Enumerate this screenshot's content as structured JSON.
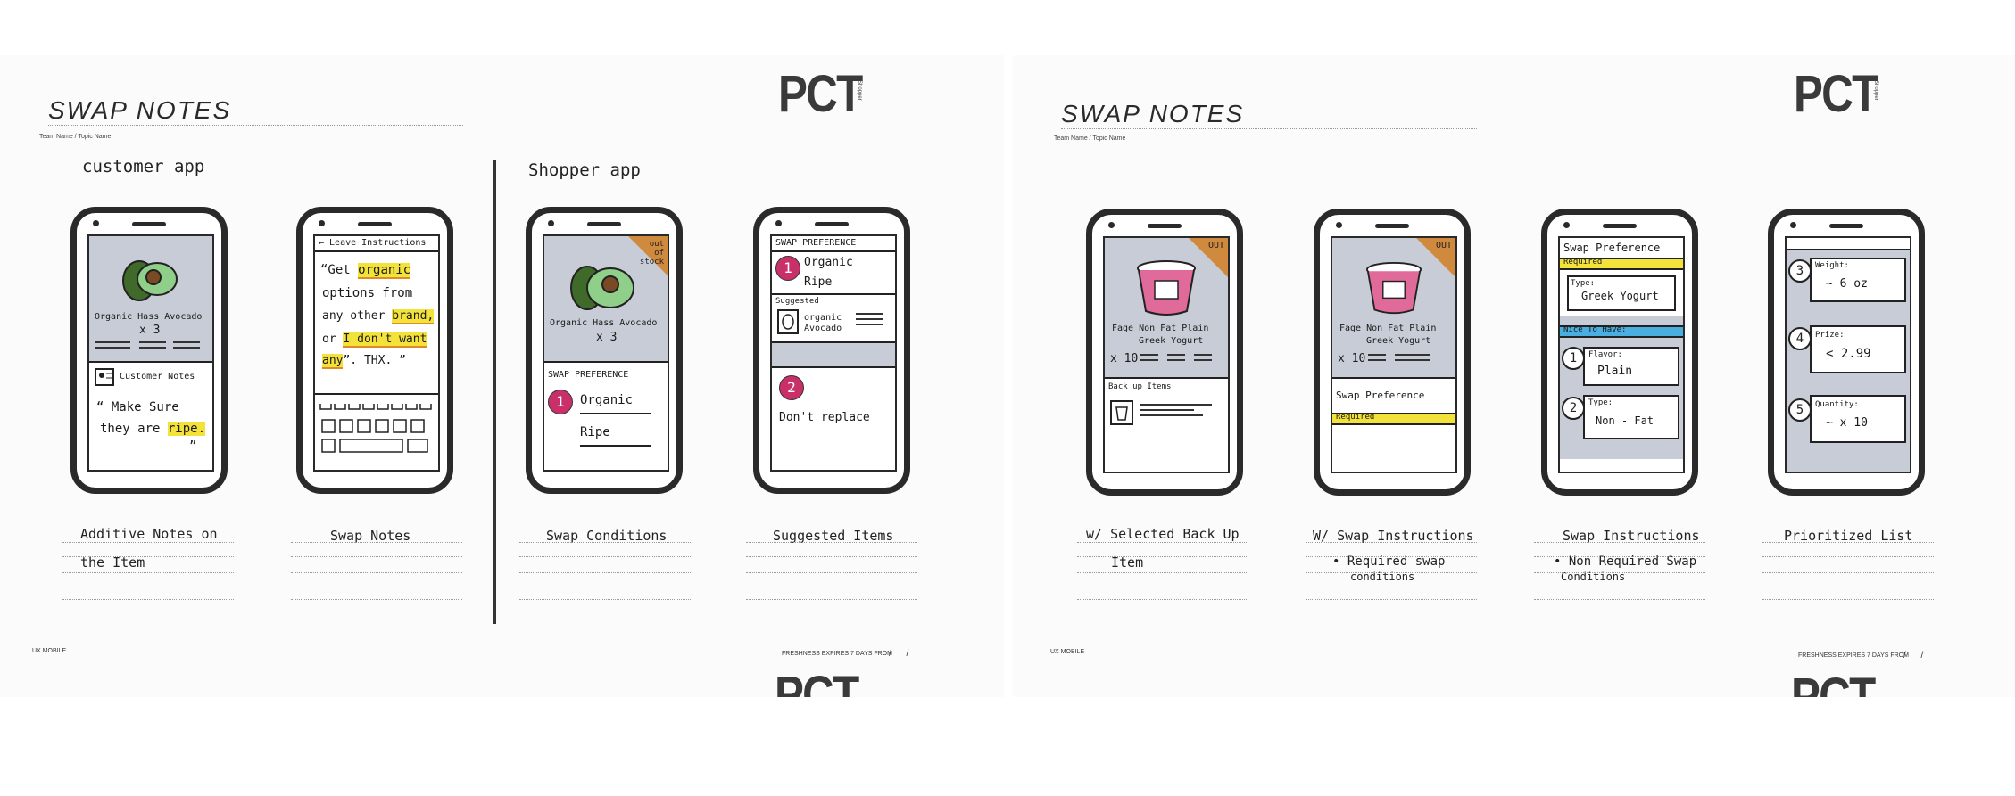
{
  "left_sheet": {
    "title": "SWAP NOTES",
    "team_label": "Team Name / Topic Name",
    "logo": "PCT",
    "logo_sub": "Shopper",
    "footer_left": "UX MOBILE",
    "footer_right": "FRESHNESS EXPIRES 7 DAYS FROM",
    "footer_slashes": "/      /",
    "bottom_logo": "PCT",
    "section_customer": "customer app",
    "section_shopper": "Shopper app",
    "phones": [
      {
        "product_name": "Organic Hass Avocado",
        "qty": "x 3",
        "notes_header": "Customer Notes",
        "note_line1": "“ Make Sure",
        "note_line2_pre": "they are ",
        "note_line2_hl": "ripe.",
        "note_close": "”",
        "caption_line1": "Additive   Notes   on",
        "caption_line2": "the  Item"
      },
      {
        "header": "← Leave  Instructions",
        "l1_pre": "“Get ",
        "l1_hl": "organic",
        "l2": "options  from",
        "l3_pre": "any  other ",
        "l3_hl": "brand,",
        "l4_pre": "or ",
        "l4_hl": "I don't want",
        "l5_hl": "any",
        "l5_post": "”. THX. ”",
        "caption_line1": "Swap   Notes"
      },
      {
        "badge": "out of stock",
        "product_name": "Organic Hass Avocado",
        "qty": "x 3",
        "section": "SWAP PREFERENCE",
        "num": "1",
        "pref1": "Organic",
        "pref2": "Ripe",
        "caption_line1": "Swap   Conditions"
      },
      {
        "header": "SWAP PREFERENCE",
        "num1": "1",
        "pref1": "Organic",
        "pref2": "Ripe",
        "suggested": "Suggested",
        "sugg_item": "organic Avocado",
        "num2": "2",
        "dont": "Don't  replace",
        "caption_line1": "Suggested   Items"
      }
    ]
  },
  "right_sheet": {
    "title": "SWAP NOTES",
    "team_label": "Team Name / Topic Name",
    "logo": "PCT",
    "logo_sub": "Shopper",
    "footer_left": "UX MOBILE",
    "footer_right": "FRESHNESS EXPIRES 7 DAYS FROM",
    "footer_slashes": "/      /",
    "bottom_logo": "PCT",
    "phones": [
      {
        "badge": "OUT",
        "product_name1": "Fage  Non  Fat Plain",
        "product_name2": "Greek Yogurt",
        "qty": "x 10",
        "backup": "Back up Items",
        "caption_line1": "w/ Selected  Back Up",
        "caption_line2": "Item"
      },
      {
        "badge": "OUT",
        "product_name1": "Fage  Non  Fat Plain",
        "product_name2": "Greek Yogurt",
        "qty": "x 10",
        "swap_pref": "Swap Preference",
        "required": "Required",
        "caption_line1": "W/ Swap Instructions",
        "caption_line2": "• Required  swap",
        "caption_line3": "conditions"
      },
      {
        "header": "Swap Preference",
        "required": "Required",
        "type_label": "Type:",
        "type_value": "Greek Yogurt",
        "nice": "Nice To Have:",
        "n1": "1",
        "flavor_label": "Flavor:",
        "flavor_value": "Plain",
        "n2": "2",
        "type2_label": "Type:",
        "type2_value": "Non - Fat",
        "caption_line1": "Swap  Instructions",
        "caption_line2": "• Non  Required  Swap",
        "caption_line3": "Conditions"
      },
      {
        "n3": "3",
        "weight_label": "Weight:",
        "weight_value": "~ 6 oz",
        "n4": "4",
        "prize_label": "Prize:",
        "prize_value": "< 2.99",
        "n5": "5",
        "quantity_label": "Quantity:",
        "quantity_value": "~ x 10",
        "caption_line1": "Prioritized   List"
      }
    ]
  },
  "colors": {
    "screen_grey": "#c8ccd6",
    "highlight_yellow": "#f3e23a",
    "badge_orange": "#cf8a3e",
    "number_pink": "#c9306a",
    "nice_blue": "#4aaee0",
    "avocado_green": "#8fcf8a",
    "yogurt_pink": "#e06a9a"
  }
}
